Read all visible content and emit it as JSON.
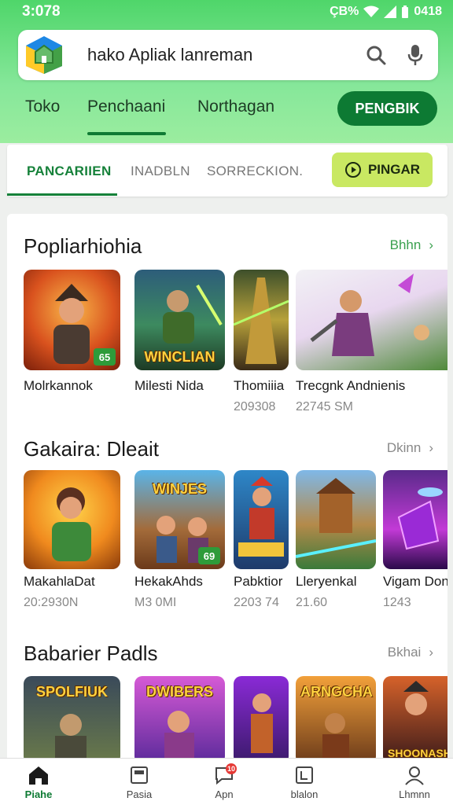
{
  "status": {
    "time": "3:078",
    "right_text": "ÇB%",
    "battery": "0418"
  },
  "search": {
    "text": "hako Apliak lanreman"
  },
  "top_tabs": [
    {
      "label": "Toko"
    },
    {
      "label": "Penchaani"
    },
    {
      "label": "Northagan"
    }
  ],
  "top_button": {
    "label": "PENGBIK"
  },
  "sub_tabs": [
    {
      "label": "PANCARIIEN"
    },
    {
      "label": "INADBLN"
    },
    {
      "label": "SORRECKION."
    }
  ],
  "play_button": {
    "label": "PINGAR"
  },
  "sections": [
    {
      "title": "Popliarhiohia",
      "more": "Bhhn",
      "apps": [
        {
          "name": "Molrkannok",
          "size": "",
          "caption": "",
          "badge": "65"
        },
        {
          "name": "Milesti Nida",
          "size": "",
          "caption": "WINCLIAN",
          "badge": ""
        },
        {
          "name": "Thomiiia",
          "size": "209308",
          "caption": "",
          "badge": ""
        },
        {
          "name": "Trecgnk Andnienis",
          "size": "22745 SM",
          "caption": "",
          "badge": ""
        }
      ]
    },
    {
      "title": "Gakaira: Dleait",
      "more": "Dkinn",
      "apps": [
        {
          "name": "MakahlaDat",
          "size": "20:2930N",
          "caption": "",
          "badge": ""
        },
        {
          "name": "HekakAhds",
          "size": "M3 0MI",
          "caption": "WINJES",
          "badge": "69"
        },
        {
          "name": "Pabktior",
          "size": "2203 74",
          "caption": "",
          "badge": ""
        },
        {
          "name": "Lleryenkal",
          "size": "21.60",
          "caption": "",
          "badge": ""
        },
        {
          "name": "Vigam Don",
          "size": "1243",
          "caption": "",
          "badge": ""
        }
      ]
    },
    {
      "title": "Babarier Padls",
      "more": "Bkhai",
      "apps": [
        {
          "name": "",
          "size": "",
          "caption": "SPOLFIUK",
          "badge": ""
        },
        {
          "name": "",
          "size": "",
          "caption": "DWIBERS",
          "badge": ""
        },
        {
          "name": "",
          "size": "",
          "caption": "",
          "badge": ""
        },
        {
          "name": "",
          "size": "",
          "caption": "ARNGCHA",
          "badge": ""
        },
        {
          "name": "",
          "size": "",
          "caption": "SHOONASH",
          "badge": ""
        }
      ]
    }
  ],
  "bottom_nav": [
    {
      "label": "Piahe",
      "icon": "home-icon"
    },
    {
      "label": "Pasia",
      "icon": "image-icon"
    },
    {
      "label": "Apn",
      "icon": "chat-icon",
      "badge": "10"
    },
    {
      "label": "blalon",
      "icon": "book-icon"
    },
    {
      "label": "Lhmnn",
      "icon": "profile-icon"
    }
  ],
  "colors": {
    "header_green": "#4fd66a",
    "accent_green": "#0d7a33",
    "play_yellow": "#c9e862"
  }
}
